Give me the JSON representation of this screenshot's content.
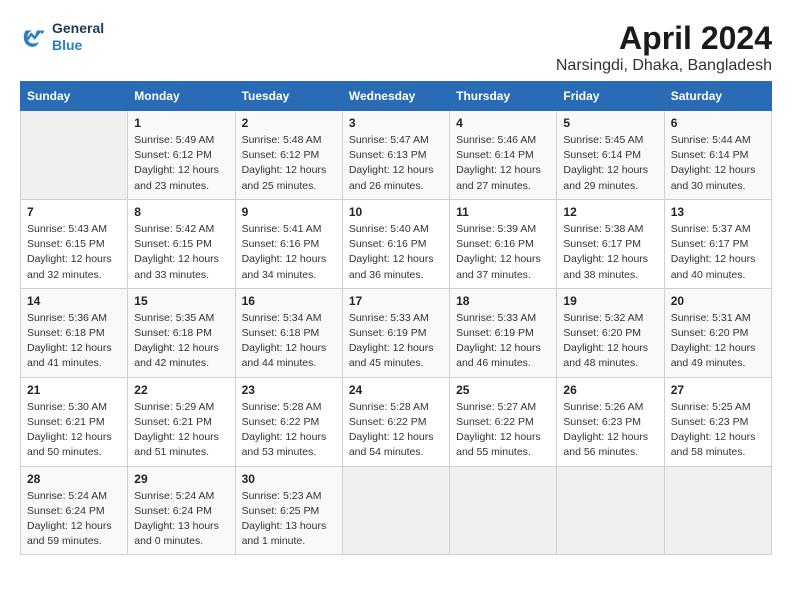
{
  "logo": {
    "line1": "General",
    "line2": "Blue"
  },
  "title": "April 2024",
  "location": "Narsingdi, Dhaka, Bangladesh",
  "header": {
    "days": [
      "Sunday",
      "Monday",
      "Tuesday",
      "Wednesday",
      "Thursday",
      "Friday",
      "Saturday"
    ]
  },
  "weeks": [
    [
      {
        "day": "",
        "info": ""
      },
      {
        "day": "1",
        "info": "Sunrise: 5:49 AM\nSunset: 6:12 PM\nDaylight: 12 hours\nand 23 minutes."
      },
      {
        "day": "2",
        "info": "Sunrise: 5:48 AM\nSunset: 6:12 PM\nDaylight: 12 hours\nand 25 minutes."
      },
      {
        "day": "3",
        "info": "Sunrise: 5:47 AM\nSunset: 6:13 PM\nDaylight: 12 hours\nand 26 minutes."
      },
      {
        "day": "4",
        "info": "Sunrise: 5:46 AM\nSunset: 6:14 PM\nDaylight: 12 hours\nand 27 minutes."
      },
      {
        "day": "5",
        "info": "Sunrise: 5:45 AM\nSunset: 6:14 PM\nDaylight: 12 hours\nand 29 minutes."
      },
      {
        "day": "6",
        "info": "Sunrise: 5:44 AM\nSunset: 6:14 PM\nDaylight: 12 hours\nand 30 minutes."
      }
    ],
    [
      {
        "day": "7",
        "info": "Sunrise: 5:43 AM\nSunset: 6:15 PM\nDaylight: 12 hours\nand 32 minutes."
      },
      {
        "day": "8",
        "info": "Sunrise: 5:42 AM\nSunset: 6:15 PM\nDaylight: 12 hours\nand 33 minutes."
      },
      {
        "day": "9",
        "info": "Sunrise: 5:41 AM\nSunset: 6:16 PM\nDaylight: 12 hours\nand 34 minutes."
      },
      {
        "day": "10",
        "info": "Sunrise: 5:40 AM\nSunset: 6:16 PM\nDaylight: 12 hours\nand 36 minutes."
      },
      {
        "day": "11",
        "info": "Sunrise: 5:39 AM\nSunset: 6:16 PM\nDaylight: 12 hours\nand 37 minutes."
      },
      {
        "day": "12",
        "info": "Sunrise: 5:38 AM\nSunset: 6:17 PM\nDaylight: 12 hours\nand 38 minutes."
      },
      {
        "day": "13",
        "info": "Sunrise: 5:37 AM\nSunset: 6:17 PM\nDaylight: 12 hours\nand 40 minutes."
      }
    ],
    [
      {
        "day": "14",
        "info": "Sunrise: 5:36 AM\nSunset: 6:18 PM\nDaylight: 12 hours\nand 41 minutes."
      },
      {
        "day": "15",
        "info": "Sunrise: 5:35 AM\nSunset: 6:18 PM\nDaylight: 12 hours\nand 42 minutes."
      },
      {
        "day": "16",
        "info": "Sunrise: 5:34 AM\nSunset: 6:18 PM\nDaylight: 12 hours\nand 44 minutes."
      },
      {
        "day": "17",
        "info": "Sunrise: 5:33 AM\nSunset: 6:19 PM\nDaylight: 12 hours\nand 45 minutes."
      },
      {
        "day": "18",
        "info": "Sunrise: 5:33 AM\nSunset: 6:19 PM\nDaylight: 12 hours\nand 46 minutes."
      },
      {
        "day": "19",
        "info": "Sunrise: 5:32 AM\nSunset: 6:20 PM\nDaylight: 12 hours\nand 48 minutes."
      },
      {
        "day": "20",
        "info": "Sunrise: 5:31 AM\nSunset: 6:20 PM\nDaylight: 12 hours\nand 49 minutes."
      }
    ],
    [
      {
        "day": "21",
        "info": "Sunrise: 5:30 AM\nSunset: 6:21 PM\nDaylight: 12 hours\nand 50 minutes."
      },
      {
        "day": "22",
        "info": "Sunrise: 5:29 AM\nSunset: 6:21 PM\nDaylight: 12 hours\nand 51 minutes."
      },
      {
        "day": "23",
        "info": "Sunrise: 5:28 AM\nSunset: 6:22 PM\nDaylight: 12 hours\nand 53 minutes."
      },
      {
        "day": "24",
        "info": "Sunrise: 5:28 AM\nSunset: 6:22 PM\nDaylight: 12 hours\nand 54 minutes."
      },
      {
        "day": "25",
        "info": "Sunrise: 5:27 AM\nSunset: 6:22 PM\nDaylight: 12 hours\nand 55 minutes."
      },
      {
        "day": "26",
        "info": "Sunrise: 5:26 AM\nSunset: 6:23 PM\nDaylight: 12 hours\nand 56 minutes."
      },
      {
        "day": "27",
        "info": "Sunrise: 5:25 AM\nSunset: 6:23 PM\nDaylight: 12 hours\nand 58 minutes."
      }
    ],
    [
      {
        "day": "28",
        "info": "Sunrise: 5:24 AM\nSunset: 6:24 PM\nDaylight: 12 hours\nand 59 minutes."
      },
      {
        "day": "29",
        "info": "Sunrise: 5:24 AM\nSunset: 6:24 PM\nDaylight: 13 hours\nand 0 minutes."
      },
      {
        "day": "30",
        "info": "Sunrise: 5:23 AM\nSunset: 6:25 PM\nDaylight: 13 hours\nand 1 minute."
      },
      {
        "day": "",
        "info": ""
      },
      {
        "day": "",
        "info": ""
      },
      {
        "day": "",
        "info": ""
      },
      {
        "day": "",
        "info": ""
      }
    ]
  ]
}
